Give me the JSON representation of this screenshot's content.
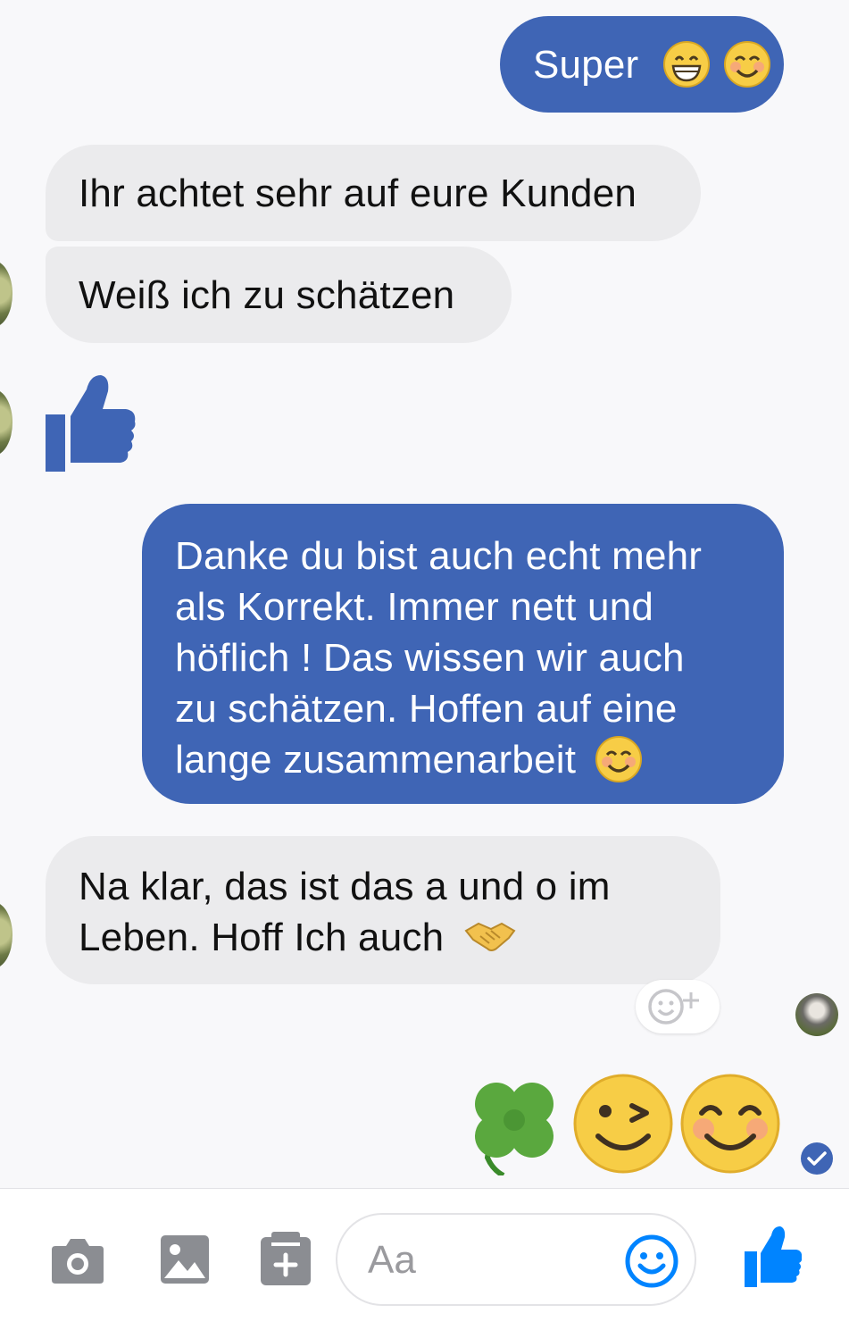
{
  "messages": [
    {
      "id": "m1",
      "direction": "out",
      "text": "Super"
    },
    {
      "id": "m2",
      "direction": "in",
      "text": "Ihr achtet sehr auf eure Kunden"
    },
    {
      "id": "m3",
      "direction": "in",
      "text": "Weiß ich zu schätzen"
    },
    {
      "id": "m4",
      "direction": "in",
      "type": "like",
      "icon": "thumbs-up-icon"
    },
    {
      "id": "m5",
      "direction": "out",
      "lines": [
        "Danke du bist auch echt mehr",
        "als Korrekt. Immer nett und",
        "höflich ! Das wissen wir auch",
        "zu schätzen. Hoffen auf eine",
        "lange zusammenarbeit"
      ]
    },
    {
      "id": "m6",
      "direction": "in",
      "lines": [
        "Na klar, das ist das a und o im",
        "Leben. Hoff Ich auch"
      ]
    },
    {
      "id": "m7",
      "direction": "out",
      "type": "emoji-only",
      "icons": [
        "four-leaf-clover-icon",
        "winking-face-icon",
        "smiling-face-icon"
      ]
    }
  ],
  "composer": {
    "placeholder": "Aa",
    "icons": [
      "camera-icon",
      "image-icon",
      "add-attachment-icon",
      "emoji-icon",
      "like-icon"
    ]
  },
  "colors": {
    "outgoing_bubble": "#3f65b5",
    "incoming_bubble": "#ebebed",
    "accent": "#0084ff"
  }
}
